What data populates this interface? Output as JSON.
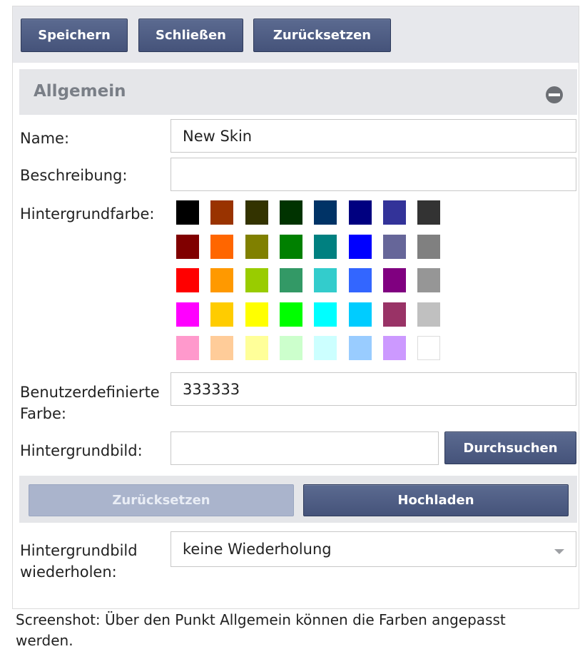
{
  "toolbar": {
    "save_label": "Speichern",
    "close_label": "Schließen",
    "reset_label": "Zurücksetzen"
  },
  "section": {
    "title": "Allgemein"
  },
  "form": {
    "name_label": "Name:",
    "name_value": "New Skin",
    "description_label": "Beschreibung:",
    "description_value": "",
    "bg_color_label": "Hintergrundfarbe:",
    "custom_color_label_line1": "Benutzerdefinierte",
    "custom_color_label_line2": "Farbe:",
    "custom_color_value": "333333",
    "bg_image_label": "Hintergrundbild:",
    "bg_image_value": "",
    "browse_label": "Durchsuchen",
    "upload_reset_label": "Zurücksetzen",
    "upload_label": "Hochladen",
    "repeat_label_line1": "Hintergrundbild",
    "repeat_label_line2": "wiederholen:",
    "repeat_value": "keine Wiederholung"
  },
  "palette": [
    [
      "#000000",
      "#993300",
      "#333300",
      "#003300",
      "#003366",
      "#000080",
      "#333399",
      "#333333"
    ],
    [
      "#800000",
      "#FF6600",
      "#808000",
      "#008000",
      "#008080",
      "#0000FF",
      "#666699",
      "#808080"
    ],
    [
      "#FF0000",
      "#FF9900",
      "#99CC00",
      "#339966",
      "#33CCCC",
      "#3366FF",
      "#800080",
      "#969696"
    ],
    [
      "#FF00FF",
      "#FFCC00",
      "#FFFF00",
      "#00FF00",
      "#00FFFF",
      "#00CCFF",
      "#993366",
      "#C0C0C0"
    ],
    [
      "#FF99CC",
      "#FFCC99",
      "#FFFF99",
      "#CCFFCC",
      "#CCFFFF",
      "#99CCFF",
      "#CC99FF",
      "#FFFFFF"
    ]
  ],
  "caption": "Screenshot: Über den Punkt Allgemein können die Farben angepasst werden.",
  "colors": {
    "button": "#4f5d82",
    "button_disabled": "#aab4cc",
    "panel": "#e5e6e9"
  }
}
